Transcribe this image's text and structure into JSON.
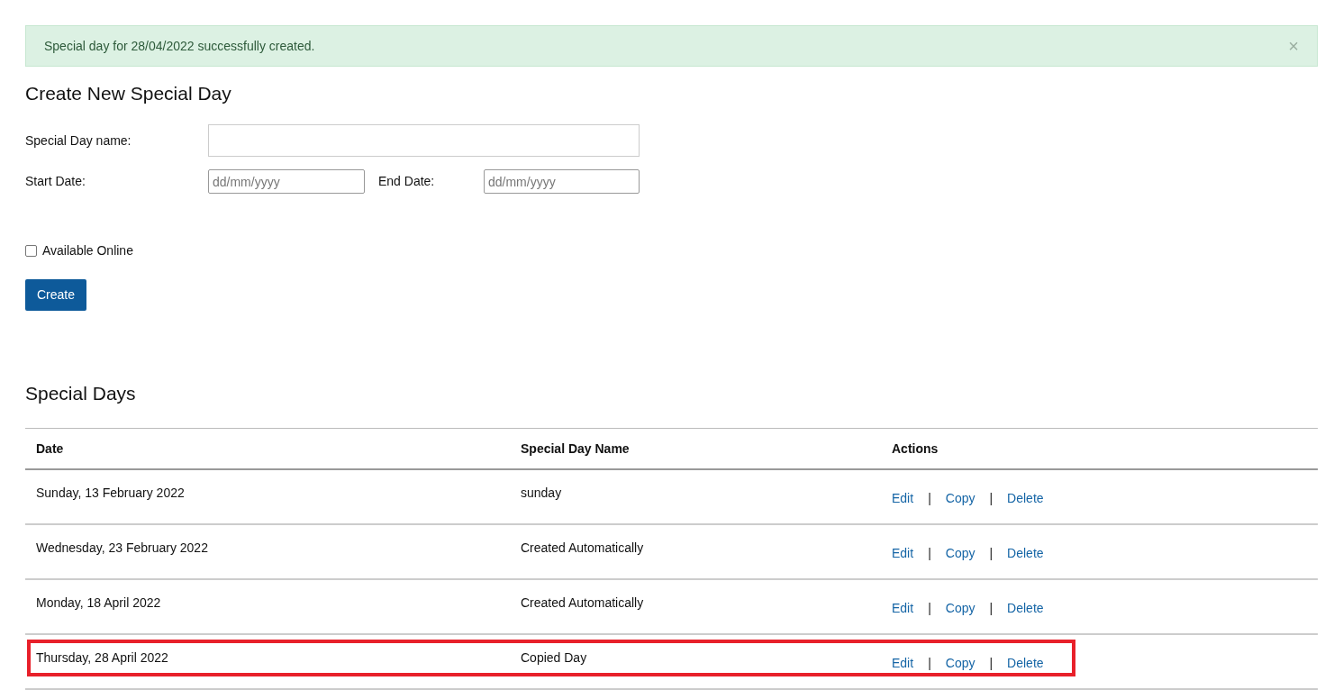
{
  "alert": {
    "message": "Special day for 28/04/2022 successfully created.",
    "close": "×"
  },
  "form": {
    "title": "Create New Special Day",
    "name_field": {
      "label": "Special Day name:"
    },
    "start_date": {
      "label": "Start Date:",
      "placeholder": "dd/mm/yyyy"
    },
    "end_date": {
      "label": "End Date:",
      "placeholder": "dd/mm/yyyy"
    },
    "available_online": {
      "label": "Available Online",
      "checked": false
    },
    "submit": "Create"
  },
  "list": {
    "title": "Special Days",
    "columns": [
      "Date",
      "Special Day Name",
      "Actions"
    ],
    "rows": [
      {
        "date": "Sunday, 13 February 2022",
        "name": "sunday",
        "highlighted": false,
        "actions": [
          {
            "kind": "link",
            "label": "Edit"
          },
          {
            "kind": "separator",
            "label": "|"
          },
          {
            "kind": "link",
            "label": "Copy"
          },
          {
            "kind": "separator",
            "label": "|"
          },
          {
            "kind": "link",
            "label": "Delete"
          }
        ]
      },
      {
        "date": "Wednesday, 23 February 2022",
        "name": "Created Automatically",
        "highlighted": false,
        "actions": [
          {
            "kind": "link",
            "label": "Edit"
          },
          {
            "kind": "separator",
            "label": "|"
          },
          {
            "kind": "link",
            "label": "Copy"
          },
          {
            "kind": "separator",
            "label": "|"
          },
          {
            "kind": "link",
            "label": "Delete"
          }
        ]
      },
      {
        "date": "Monday, 18 April 2022",
        "name": "Created Automatically",
        "highlighted": false,
        "actions": [
          {
            "kind": "link",
            "label": "Edit"
          },
          {
            "kind": "separator",
            "label": "|"
          },
          {
            "kind": "link",
            "label": "Copy"
          },
          {
            "kind": "separator",
            "label": "|"
          },
          {
            "kind": "link",
            "label": "Delete"
          }
        ]
      },
      {
        "date": "Thursday, 28 April 2022",
        "name": "Copied Day",
        "highlighted": true,
        "actions": [
          {
            "kind": "link",
            "label": "Edit"
          },
          {
            "kind": "separator",
            "label": "|"
          },
          {
            "kind": "link",
            "label": "Copy"
          },
          {
            "kind": "separator",
            "label": "|"
          },
          {
            "kind": "link",
            "label": "Delete"
          }
        ]
      }
    ]
  }
}
